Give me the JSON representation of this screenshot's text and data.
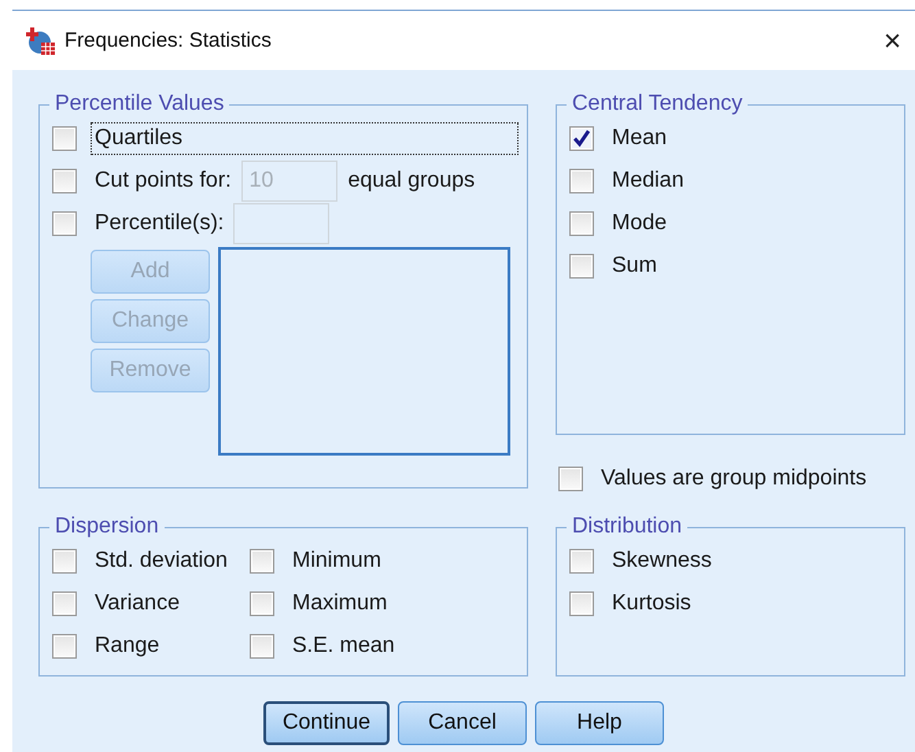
{
  "window": {
    "title": "Frequencies: Statistics",
    "close": "×"
  },
  "percentile_values": {
    "title": "Percentile Values",
    "quartiles": {
      "label": "Quartiles",
      "checked": false,
      "focused": true
    },
    "cut_points": {
      "label": "Cut points for:",
      "checked": false,
      "value": "10",
      "field_disabled": true,
      "suffix": "equal groups"
    },
    "percentiles": {
      "label": "Percentile(s):",
      "checked": false,
      "field_disabled": true
    },
    "buttons": [
      {
        "label": "Add",
        "disabled": true
      },
      {
        "label": "Change",
        "disabled": true
      },
      {
        "label": "Remove",
        "disabled": true
      }
    ]
  },
  "central_tendency": {
    "title": "Central Tendency",
    "items": [
      {
        "label": "Mean",
        "checked": true
      },
      {
        "label": "Median",
        "checked": false
      },
      {
        "label": "Mode",
        "checked": false
      },
      {
        "label": "Sum",
        "checked": false
      }
    ]
  },
  "group_midpoints": {
    "label": "Values are group midpoints",
    "checked": false
  },
  "dispersion": {
    "title": "Dispersion",
    "items": [
      {
        "label": "Std. deviation",
        "checked": false
      },
      {
        "label": "Minimum",
        "checked": false
      },
      {
        "label": "Variance",
        "checked": false
      },
      {
        "label": "Maximum",
        "checked": false
      },
      {
        "label": "Range",
        "checked": false
      },
      {
        "label": "S.E. mean",
        "checked": false
      }
    ]
  },
  "distribution": {
    "title": "Distribution",
    "items": [
      {
        "label": "Skewness",
        "checked": false
      },
      {
        "label": "Kurtosis",
        "checked": false
      }
    ]
  },
  "buttons": [
    {
      "label": "Continue",
      "default": true
    },
    {
      "label": "Cancel",
      "default": false
    },
    {
      "label": "Help",
      "default": false
    }
  ]
}
